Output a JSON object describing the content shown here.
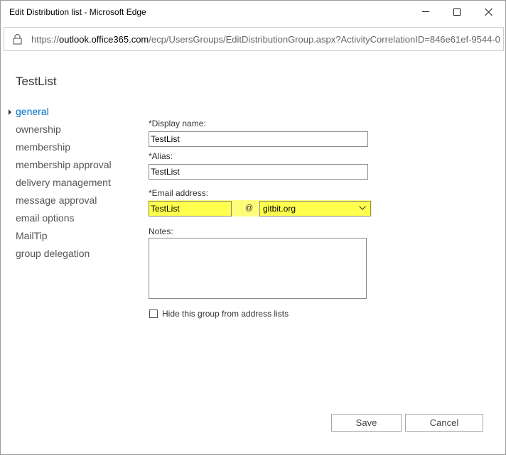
{
  "window": {
    "title": "Edit Distribution list - Microsoft Edge"
  },
  "address_bar": {
    "url_prefix": "https://",
    "url_host": "outlook.office365.com",
    "url_path": "/ecp/UsersGroups/EditDistributionGroup.aspx?ActivityCorrelationID=846e61ef-9544-0"
  },
  "page": {
    "title": "TestList"
  },
  "nav": {
    "items": [
      {
        "label": "general",
        "active": true
      },
      {
        "label": "ownership",
        "active": false
      },
      {
        "label": "membership",
        "active": false
      },
      {
        "label": "membership approval",
        "active": false
      },
      {
        "label": "delivery management",
        "active": false
      },
      {
        "label": "message approval",
        "active": false
      },
      {
        "label": "email options",
        "active": false
      },
      {
        "label": "MailTip",
        "active": false
      },
      {
        "label": "group delegation",
        "active": false
      }
    ]
  },
  "form": {
    "display_name_label": "*Display name:",
    "display_name_value": "TestList",
    "alias_label": "*Alias:",
    "alias_value": "TestList",
    "email_label": "*Email address:",
    "email_local_value": "TestList",
    "email_at": "@",
    "email_domain_value": "gitbit.org",
    "notes_label": "Notes:",
    "notes_value": "",
    "hide_checkbox_label": "Hide this group from address lists",
    "hide_checked": false
  },
  "buttons": {
    "save": "Save",
    "cancel": "Cancel"
  },
  "colors": {
    "accent": "#0072c6",
    "highlight": "#ffff4d"
  }
}
